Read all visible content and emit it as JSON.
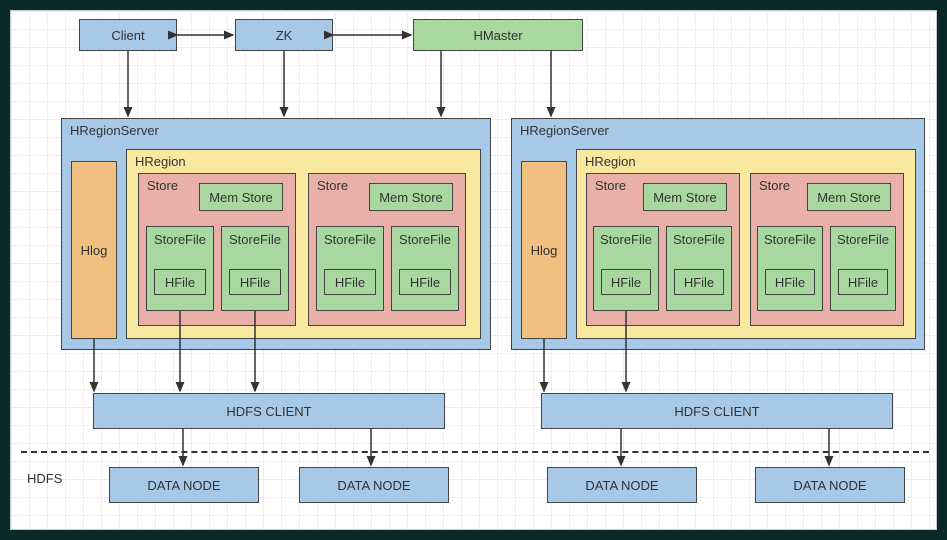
{
  "top": {
    "client": "Client",
    "zk": "ZK",
    "hmaster": "HMaster"
  },
  "rs": {
    "title": "HRegionServer",
    "hlog": "Hlog",
    "hregion": "HRegion",
    "store": "Store",
    "memstore": "Mem Store",
    "storefile": "StoreFile",
    "hfile": "HFile"
  },
  "bottom": {
    "hdfsclient": "HDFS CLIENT",
    "datanode": "DATA NODE",
    "hdfs": "HDFS"
  }
}
